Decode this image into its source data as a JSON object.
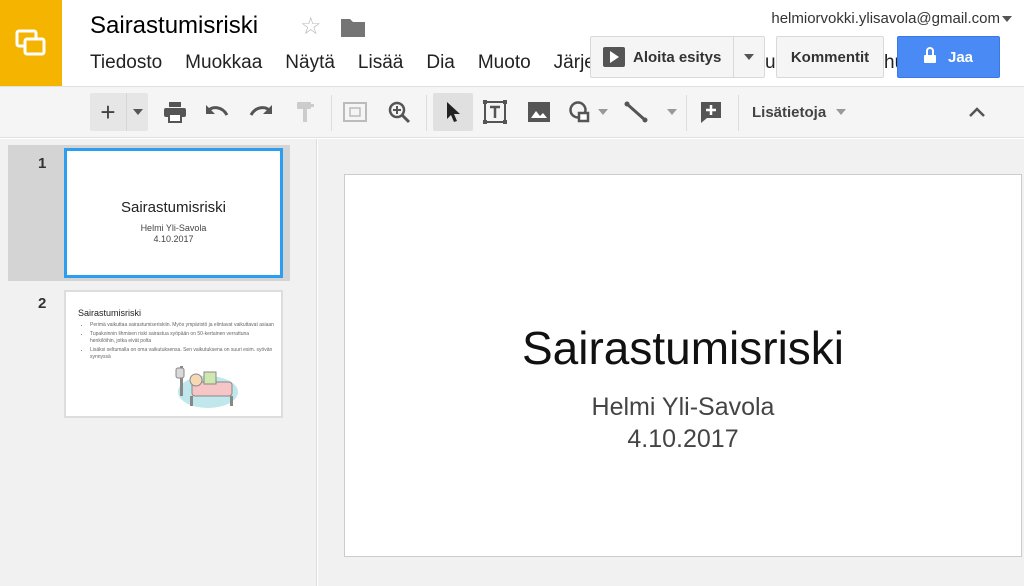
{
  "header": {
    "title": "Sairastumisriski",
    "account": "helmiorvokki.ylisavola@gmail.com",
    "present_label": "Aloita esitys",
    "comments_label": "Kommentit",
    "share_label": "Jaa"
  },
  "menu": {
    "items": [
      "Tiedosto",
      "Muokkaa",
      "Näytä",
      "Lisää",
      "Dia",
      "Muoto",
      "Järjes"
    ],
    "overflow_a": "uk",
    "overflow_b": "hu"
  },
  "toolbar": {
    "more_label": "Lisätietoja"
  },
  "filmstrip": {
    "slides": [
      {
        "number": "1",
        "title": "Sairastumisriski",
        "line1": "Helmi Yli-Savola",
        "line2": "4.10.2017"
      },
      {
        "number": "2",
        "title": "Sairastumisriski",
        "bullets": [
          "Perimä vaikuttaa sairastumiseriskiin. Myös ympäristö ja elintavat vaikuttavat asiaan",
          "Tupakoinnin lihmisen riski sairastua syöpään on 50-kertainen verrattuna henkilöihin, jotka eivät polta",
          "Lisäksi seltumalla on oma vaikutuksensa. Sen vaikutuksena on suuri esim. syövän synnyssä"
        ]
      }
    ]
  },
  "slide": {
    "title": "Sairastumisriski",
    "subtitle_line1": "Helmi Yli-Savola",
    "subtitle_line2": "4.10.2017"
  },
  "colors": {
    "brand": "#f4b400",
    "share": "#4a8af4",
    "selection": "#2b9ef0"
  }
}
